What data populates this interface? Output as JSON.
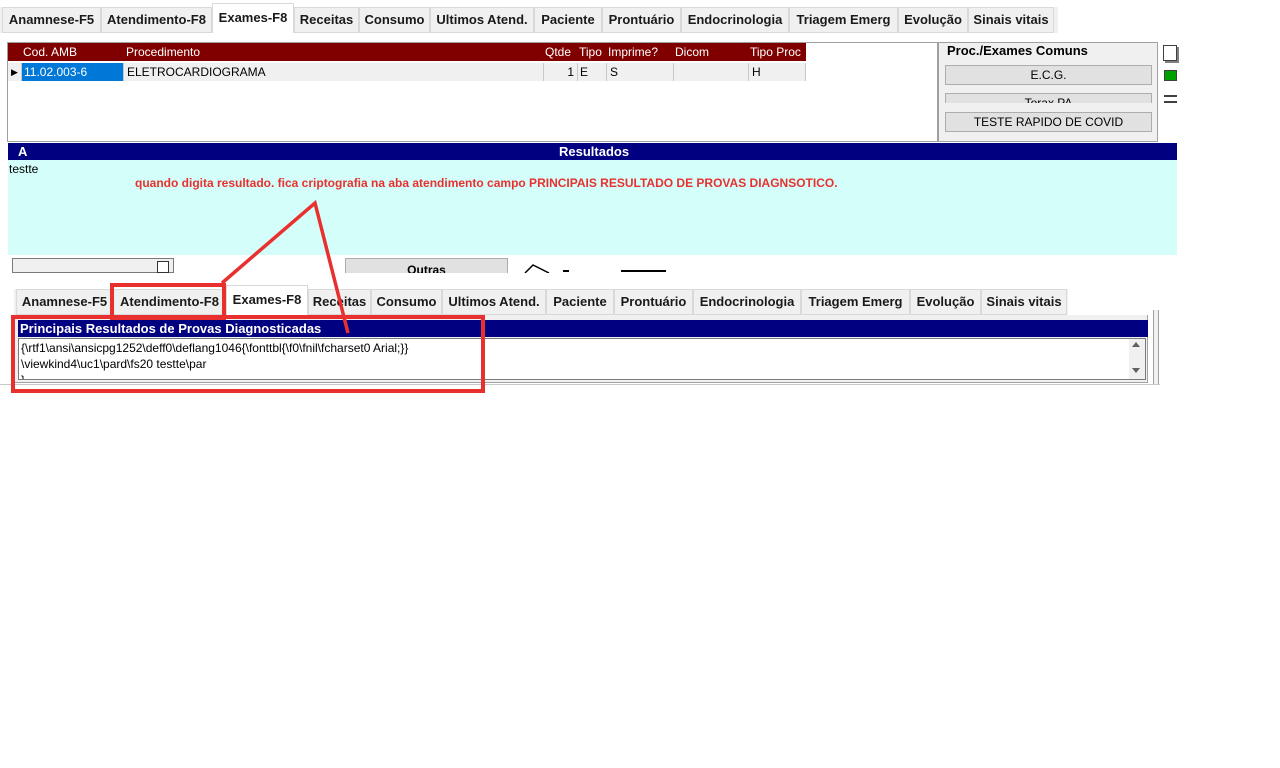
{
  "top_tabs": [
    {
      "label": "Anamnese-F5",
      "active": false
    },
    {
      "label": "Atendimento-F8",
      "active": false
    },
    {
      "label": "Exames-F8",
      "active": true
    },
    {
      "label": "Receitas",
      "active": false
    },
    {
      "label": "Consumo",
      "active": false
    },
    {
      "label": "Ultimos Atend.",
      "active": false
    },
    {
      "label": "Paciente",
      "active": false
    },
    {
      "label": "Prontuário",
      "active": false
    },
    {
      "label": "Endocrinologia",
      "active": false
    },
    {
      "label": "Triagem Emerg",
      "active": false
    },
    {
      "label": "Evolução",
      "active": false
    },
    {
      "label": "Sinais vitais",
      "active": false
    }
  ],
  "exam_grid": {
    "columns": [
      "Cod. AMB",
      "Procedimento",
      "Qtde",
      "Tipo",
      "Imprime?",
      "Dicom",
      "Tipo Proc"
    ],
    "rows": [
      {
        "cod": "11.02.003-6",
        "procedimento": "ELETROCARDIOGRAMA",
        "qtde": "1",
        "tipo": "E",
        "imprime": "S",
        "dicom": "",
        "tipo_proc": "H"
      }
    ]
  },
  "common_exams": {
    "title": "Proc./Exames Comuns",
    "buttons": [
      "E.C.G.",
      "Torax PA",
      "TESTE RAPIDO DE COVID"
    ]
  },
  "results": {
    "left_label": "A",
    "title": "Resultados",
    "text": "testte",
    "annotation": "quando digita resultado. fica  criptografia na aba atendimento campo PRINCIPAIS RESULTADO DE PROVAS DIAGNSOTICO."
  },
  "lower_controls": {
    "outras_button": "Outras"
  },
  "bottom_tabs": [
    {
      "label": "Anamnese-F5",
      "active": false
    },
    {
      "label": "Atendimento-F8",
      "active": false
    },
    {
      "label": "Exames-F8",
      "active": true
    },
    {
      "label": "Receitas",
      "active": false
    },
    {
      "label": "Consumo",
      "active": false
    },
    {
      "label": "Ultimos Atend.",
      "active": false
    },
    {
      "label": "Paciente",
      "active": false
    },
    {
      "label": "Prontuário",
      "active": false
    },
    {
      "label": "Endocrinologia",
      "active": false
    },
    {
      "label": "Triagem Emerg",
      "active": false
    },
    {
      "label": "Evolução",
      "active": false
    },
    {
      "label": "Sinais vitais",
      "active": false
    }
  ],
  "principais": {
    "title": "Principais Resultados de Provas Diagnosticadas",
    "line1": "{\\rtf1\\ansi\\ansicpg1252\\deff0\\deflang1046{\\fonttbl{\\f0\\fnil\\fcharset0 Arial;}}",
    "line2": "\\viewkind4\\uc1\\pard\\fs20 testte\\par",
    "line3": "}"
  },
  "colors": {
    "grid_header": "#800000",
    "section_bar": "#000080",
    "results_bg": "#d4fefa",
    "selected_cell": "#0078d7",
    "annotation_red": "#e8312f"
  }
}
